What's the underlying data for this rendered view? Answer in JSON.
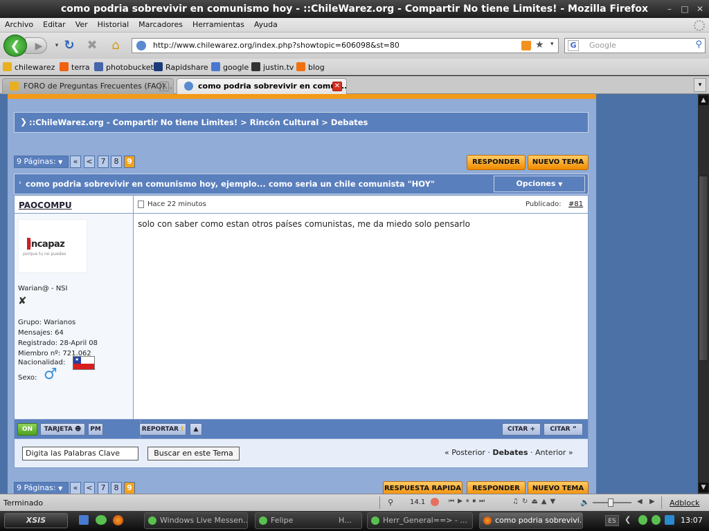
{
  "window": {
    "title": "como podria sobrevivir en comunismo hoy - ::ChileWarez.org - Compartir No tiene Limites! - Mozilla Firefox"
  },
  "menu": [
    "Archivo",
    "Editar",
    "Ver",
    "Historial",
    "Marcadores",
    "Herramientas",
    "Ayuda"
  ],
  "nav": {
    "url": "http://www.chilewarez.org/index.php?showtopic=606098&st=80",
    "search_placeholder": "Google"
  },
  "bookmarks": [
    {
      "label": "chilewarez",
      "color": "#e8b020"
    },
    {
      "label": "terra",
      "color": "#f06010"
    },
    {
      "label": "photobucket",
      "color": "#4466aa"
    },
    {
      "label": "Rapidshare",
      "color": "#1a3a7a"
    },
    {
      "label": "google",
      "color": "#4a78d0"
    },
    {
      "label": "justin.tv",
      "color": "#333333"
    },
    {
      "label": "blog",
      "color": "#f07010"
    }
  ],
  "tabs": [
    {
      "label": "FORO de Preguntas Frecuentes (FAQ)...",
      "active": false
    },
    {
      "label": "como podria sobrevivir en comun...",
      "active": true
    }
  ],
  "forum": {
    "breadcrumb": "::ChileWarez.org - Compartir No tiene Limites! > Rincón Cultural > Debates",
    "pages_label": "9 Páginas:",
    "pages": [
      "«",
      "<",
      "7",
      "8",
      "9"
    ],
    "btn_reply": "RESPONDER",
    "btn_new": "NUEVO TEMA",
    "btn_quick": "RESPUESTA RAPIDA",
    "topic_title": "como podria sobrevivir en comunismo hoy, ejemplo... como seria un chile comunista \"HOY\"",
    "options": "Opciones",
    "post": {
      "author": "PAOCOMPU",
      "time": "Hace 22 minutos",
      "published_label": "Publicado:",
      "post_no": "#81",
      "body": "solo con saber como estan otros países comunistas, me da miedo solo pensarlo",
      "avatar_text": "incapaz",
      "avatar_sub": "porque tu no puedes",
      "rank": "Warian@ - NSI",
      "group": "Grupo: Warianos",
      "messages": "Mensajes: 64",
      "registered": "Registrado: 28-April 08",
      "member_no": "Miembro nº: 721.062",
      "nationality": "Nacionalidad:",
      "sex": "Sexo:"
    },
    "post_buttons": {
      "on": "ON",
      "card": "TARJETA",
      "pm": "PM",
      "report": "REPORTAR",
      "quote1": "CITAR",
      "quote2": "CITAR"
    },
    "search_input": "Digita las Palabras Clave",
    "search_button": "Buscar en este Tema",
    "nav_prev": "« Posterior",
    "nav_cat": "Debates",
    "nav_next": "Anterior »"
  },
  "status": {
    "text": "Terminado",
    "zoom": "14.1",
    "adblock": "Adblock"
  },
  "taskbar": {
    "start": "XSIS",
    "items": [
      "Windows Live Messen...",
      "Felipe",
      "H...",
      "Herr_General==> - ...",
      "como podria sobrevivi..."
    ],
    "lang": "ES",
    "clock": "13:07"
  },
  "colors": {
    "orange_button": "#f39a1a",
    "page_bg": "#90acd7",
    "header_blue": "#4b71a6"
  }
}
